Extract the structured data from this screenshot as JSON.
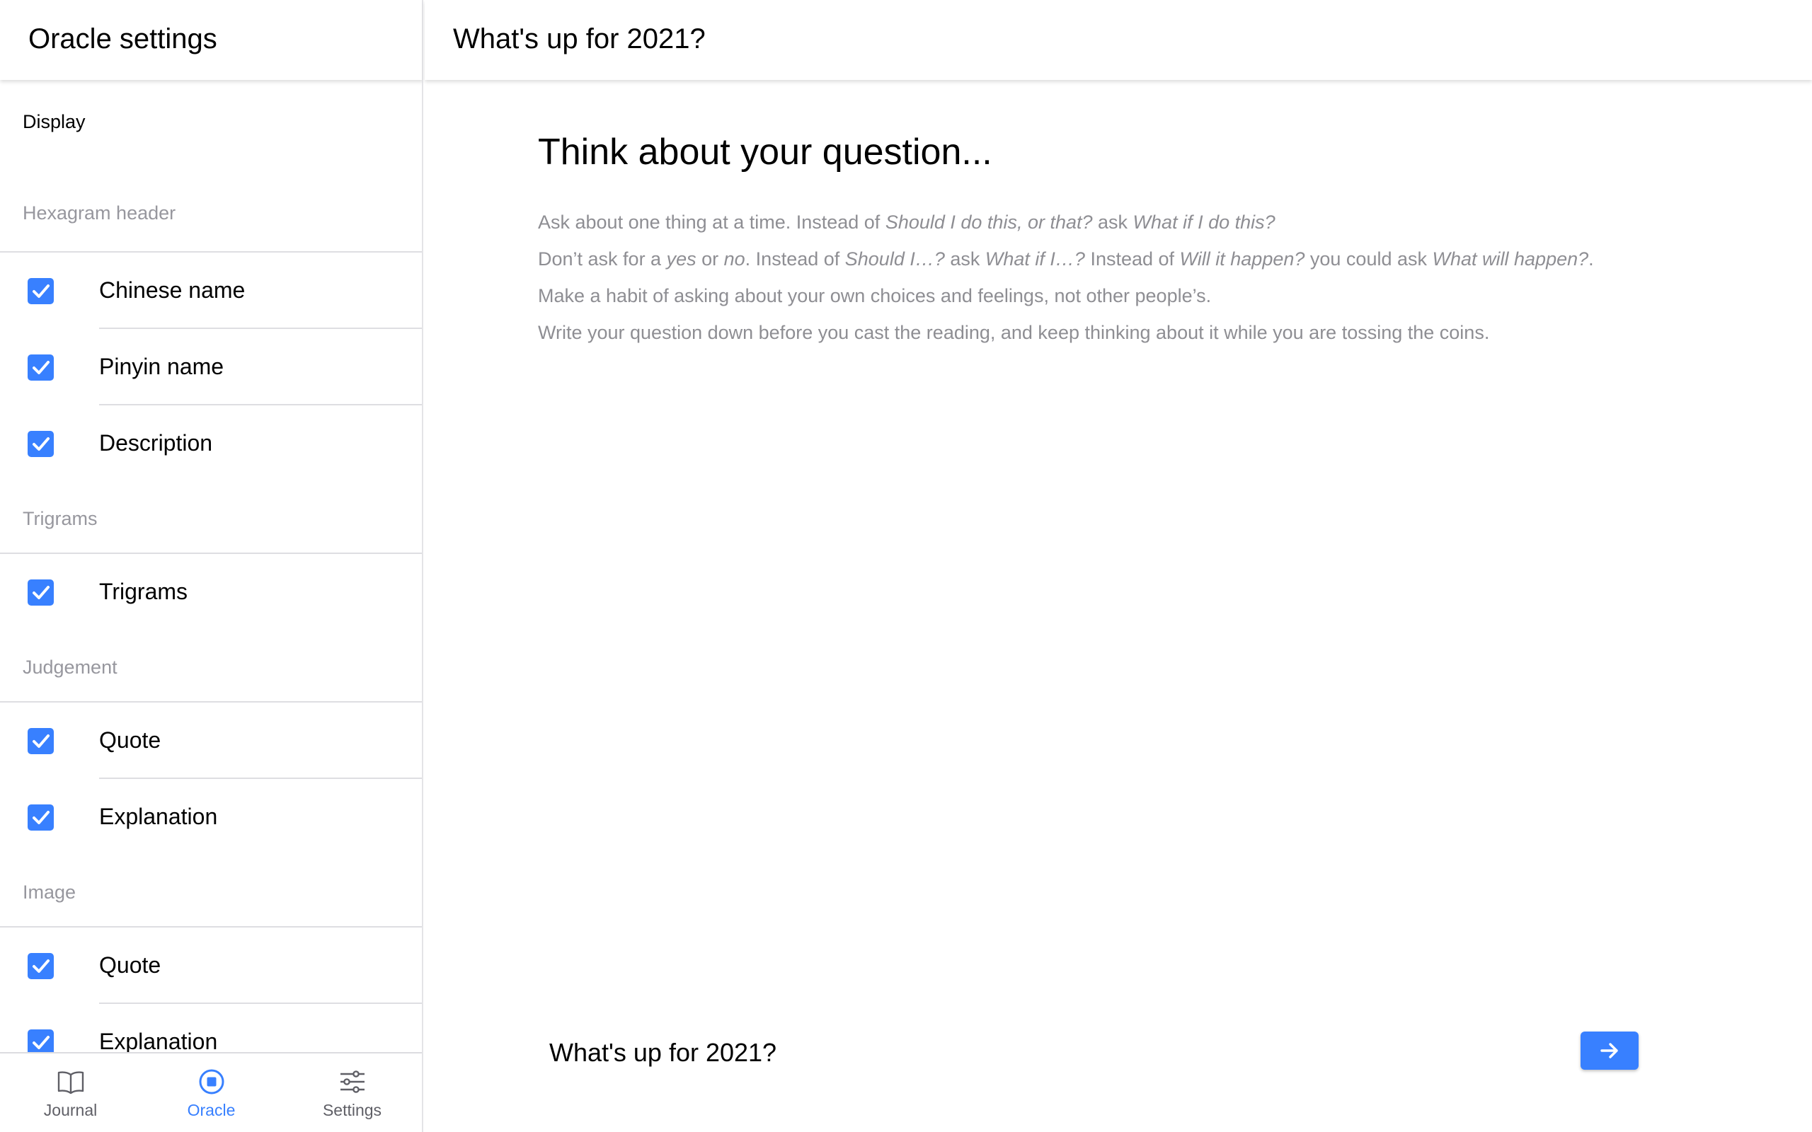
{
  "sidebar": {
    "title": "Oracle settings",
    "section_link": "Display",
    "groups": [
      {
        "label": "Hexagram header",
        "items": [
          {
            "label": "Chinese name",
            "checked": true
          },
          {
            "label": "Pinyin name",
            "checked": true
          },
          {
            "label": "Description",
            "checked": true
          }
        ]
      },
      {
        "label": "Trigrams",
        "items": [
          {
            "label": "Trigrams",
            "checked": true
          }
        ]
      },
      {
        "label": "Judgement",
        "items": [
          {
            "label": "Quote",
            "checked": true
          },
          {
            "label": "Explanation",
            "checked": true
          }
        ]
      },
      {
        "label": "Image",
        "items": [
          {
            "label": "Quote",
            "checked": true
          },
          {
            "label": "Explanation",
            "checked": true
          }
        ]
      }
    ]
  },
  "tabbar": {
    "tabs": [
      {
        "label": "Journal",
        "icon": "book-open-icon",
        "active": false
      },
      {
        "label": "Oracle",
        "icon": "radio-button-icon",
        "active": true
      },
      {
        "label": "Settings",
        "icon": "sliders-icon",
        "active": false
      }
    ]
  },
  "main": {
    "title": "What's up for 2021?",
    "heading": "Think about your question...",
    "tips": {
      "t1_a": "Ask about one thing at a time. Instead of ",
      "t1_b": "Should I do this, or that?",
      "t1_c": " ask ",
      "t1_d": "What if I do this?",
      "t2_a": "Don’t ask for a ",
      "t2_b": "yes",
      "t2_c": " or ",
      "t2_d": "no",
      "t2_e": ". Instead of ",
      "t2_f": "Should I…?",
      "t2_g": " ask ",
      "t2_h": "What if I…?",
      "t2_i": " Instead of ",
      "t2_j": "Will it happen?",
      "t2_k": " you could ask ",
      "t2_l": "What will happen?",
      "t2_m": ".",
      "t3": "Make a habit of asking about your own choices and feelings, not other people’s.",
      "t4": "Write your question down before you cast the reading, and keep thinking about it while you are tossing the coins."
    },
    "question_value": "What's up for 2021?",
    "submit_icon": "arrow-right-icon"
  },
  "colors": {
    "accent": "#3880ff",
    "muted_text": "#8e8e93",
    "group_label": "#97979e"
  }
}
